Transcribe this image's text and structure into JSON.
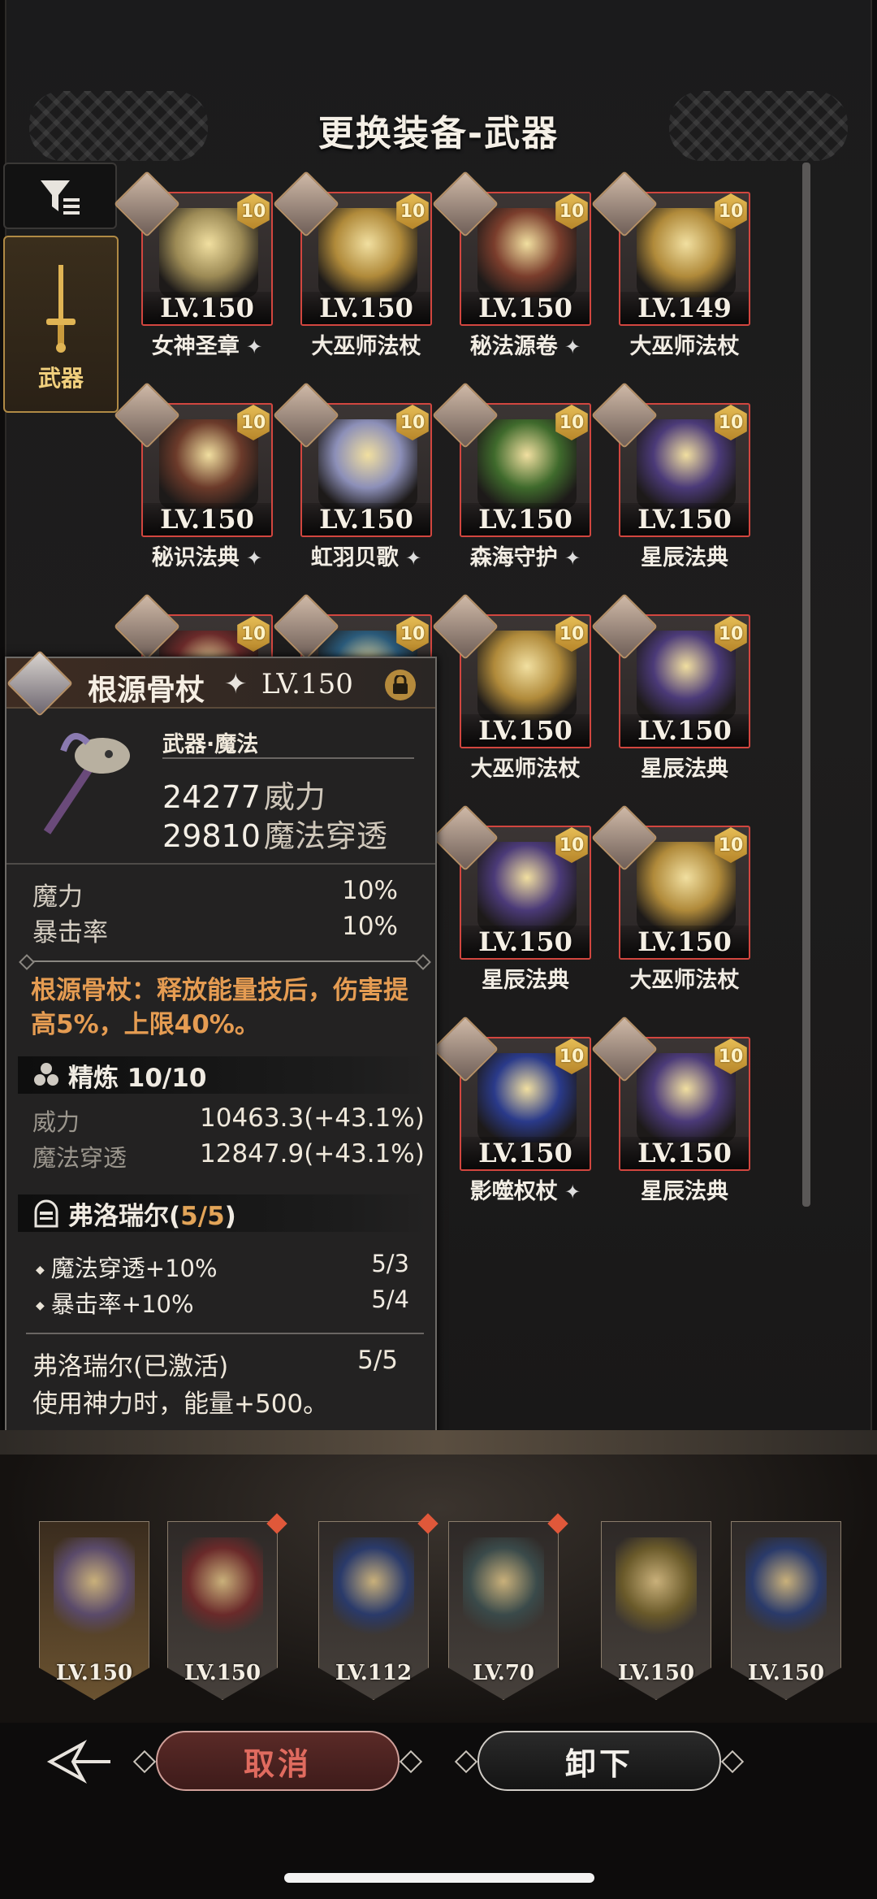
{
  "header": {
    "title": "更换装备-武器"
  },
  "side_tab": {
    "label": "武器"
  },
  "grid_items": [
    {
      "name": "女神圣章",
      "lv": "LV.150",
      "level_badge": "10",
      "star": true,
      "color": "#9c8a55"
    },
    {
      "name": "大巫师法杖",
      "lv": "LV.150",
      "level_badge": "10",
      "star": false,
      "color": "#b08a3a"
    },
    {
      "name": "秘法源卷",
      "lv": "LV.150",
      "level_badge": "10",
      "star": true,
      "color": "#7a3d2c"
    },
    {
      "name": "大巫师法杖",
      "lv": "LV.149",
      "level_badge": "10",
      "star": false,
      "color": "#b08a3a"
    },
    {
      "name": "秘识法典",
      "lv": "LV.150",
      "level_badge": "10",
      "star": true,
      "color": "#6b3a2a"
    },
    {
      "name": "虹羽贝歌",
      "lv": "LV.150",
      "level_badge": "10",
      "star": true,
      "color": "#8c8fb8"
    },
    {
      "name": "森海守护",
      "lv": "LV.150",
      "level_badge": "10",
      "star": true,
      "color": "#3f6a2c"
    },
    {
      "name": "星辰法典",
      "lv": "LV.150",
      "level_badge": "10",
      "star": false,
      "color": "#4b3a78"
    },
    {
      "name": "",
      "lv": "",
      "level_badge": "10",
      "star": false,
      "color": "#6a2a2a"
    },
    {
      "name": "",
      "lv": "",
      "level_badge": "10",
      "star": false,
      "color": "#2a5a7a"
    },
    {
      "name": "大巫师法杖",
      "lv": "LV.150",
      "level_badge": "10",
      "star": false,
      "color": "#b08a3a"
    },
    {
      "name": "星辰法典",
      "lv": "LV.150",
      "level_badge": "10",
      "star": false,
      "color": "#4b3a78"
    },
    {
      "name": "星辰法典",
      "lv": "LV.150",
      "level_badge": "10",
      "star": false,
      "color": "#4b3a78"
    },
    {
      "name": "大巫师法杖",
      "lv": "LV.150",
      "level_badge": "10",
      "star": false,
      "color": "#b08a3a"
    },
    {
      "name": "影噬权杖",
      "lv": "LV.150",
      "level_badge": "10",
      "star": true,
      "color": "#2a3a8a"
    },
    {
      "name": "星辰法典",
      "lv": "LV.150",
      "level_badge": "10",
      "star": false,
      "color": "#4b3a78"
    }
  ],
  "detail": {
    "name": "根源骨杖",
    "lv": "LV.150",
    "type": "武器·魔法",
    "power_value": "24277",
    "power_label": "威力",
    "pen_value": "29810",
    "pen_label": "魔法穿透",
    "attrs": [
      {
        "label": "魔力",
        "value": "10%"
      },
      {
        "label": "暴击率",
        "value": "10%"
      }
    ],
    "skill_text": "根源骨杖：释放能量技后，伤害提高5%，上限40%。",
    "refine_label": "精炼 10/10",
    "refine_stats": [
      {
        "label": "威力",
        "value": "10463.3(+43.1%)"
      },
      {
        "label": "魔法穿透",
        "value": "12847.9(+43.1%)"
      }
    ],
    "set_name": "弗洛瑞尔(",
    "set_count": "5/5",
    "set_close": ")",
    "set_bonuses": [
      {
        "label": "魔法穿透+10%",
        "value": "5/3"
      },
      {
        "label": "暴击率+10%",
        "value": "5/4"
      }
    ],
    "set_active_label": "弗洛瑞尔(已激活)",
    "set_active_value": "5/5",
    "set_active_effect": "使用神力时，能量+500。"
  },
  "equipment_bar": [
    {
      "lv": "LV.150",
      "selected": true,
      "color": "#5a4a6a"
    },
    {
      "lv": "LV.150",
      "selected": false,
      "color": "#6a2a2a"
    },
    {
      "lv": "LV.112",
      "selected": false,
      "color": "#2a3a6a"
    },
    {
      "lv": "LV.70",
      "selected": false,
      "color": "#3a4a4a"
    },
    {
      "lv": "LV.150",
      "selected": false,
      "color": "#6a5a2a"
    },
    {
      "lv": "LV.150",
      "selected": false,
      "color": "#2a3a6a"
    }
  ],
  "buttons": {
    "cancel": "取消",
    "unequip": "卸下"
  }
}
